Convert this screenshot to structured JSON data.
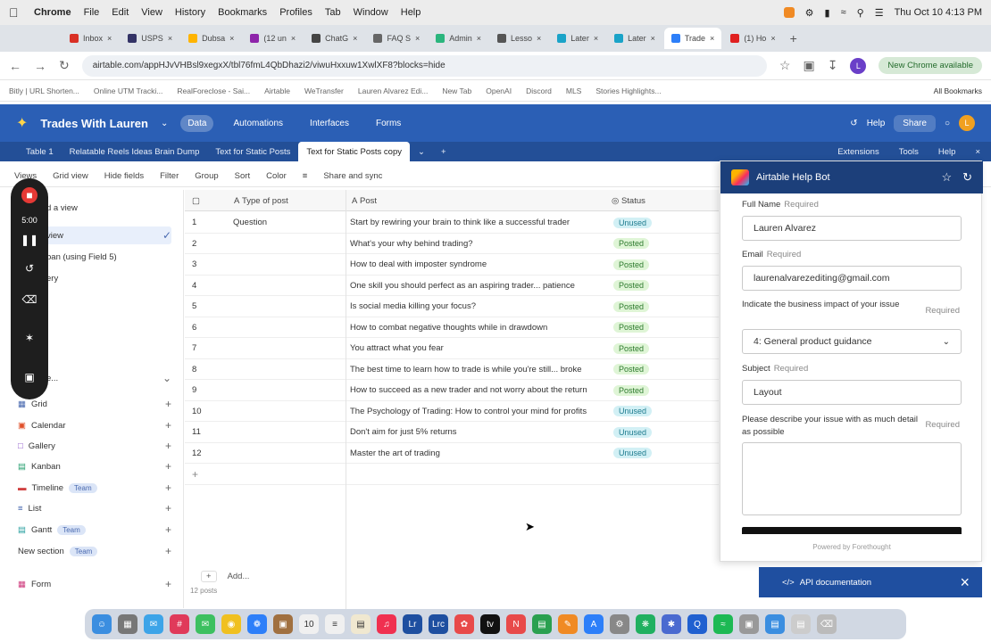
{
  "menubar": {
    "app": "Chrome",
    "menus": [
      "File",
      "Edit",
      "View",
      "History",
      "Bookmarks",
      "Profiles",
      "Tab",
      "Window",
      "Help"
    ],
    "clock": "Thu Oct 10  4:13 PM"
  },
  "tabs": [
    {
      "label": "Inbox",
      "color": "#d93025"
    },
    {
      "label": "USPS",
      "color": "#333366"
    },
    {
      "label": "Dubsa",
      "color": "#ffb400"
    },
    {
      "label": "(12 un",
      "color": "#8e24aa"
    },
    {
      "label": "ChatG",
      "color": "#444"
    },
    {
      "label": "FAQ S",
      "color": "#666"
    },
    {
      "label": "Admin",
      "color": "#2ab57d"
    },
    {
      "label": "Lesso",
      "color": "#555"
    },
    {
      "label": "Later",
      "color": "#1aa3c8"
    },
    {
      "label": "Later",
      "color": "#1aa3c8"
    },
    {
      "label": "Trade",
      "color": "#2d7ff9",
      "active": true
    },
    {
      "label": "(1) Ho",
      "color": "#e02020"
    }
  ],
  "address": {
    "url": "airtable.com/appHJvVHBsl9xegxX/tbl76fmL4QbDhazi2/viwuHxxuw1XwlXF8?blocks=hide",
    "update": "New Chrome available"
  },
  "bookmarks": [
    "Bitly | URL Shorten...",
    "Online UTM Tracki...",
    "RealForeclose - Sai...",
    "Airtable",
    "WeTransfer",
    "Lauren Alvarez Edi...",
    "New Tab",
    "OpenAI",
    "Discord",
    "MLS",
    "Stories Highlights..."
  ],
  "all_bookmarks": "All Bookmarks",
  "header": {
    "base_name": "Trades With Lauren",
    "nav": [
      "Data",
      "Automations",
      "Interfaces",
      "Forms"
    ],
    "help": "Help",
    "share": "Share",
    "avatar": "L"
  },
  "table_tabs": [
    "Table 1",
    "Relatable Reels Ideas Brain Dump",
    "Text for Static Posts",
    "Text for Static Posts copy"
  ],
  "table_tabs_right": [
    "Extensions",
    "Tools",
    "Help"
  ],
  "toolbar": {
    "views": "Views",
    "view": "Grid view",
    "items": [
      "Hide fields",
      "Filter",
      "Group",
      "Sort",
      "Color"
    ],
    "share": "Share and sync"
  },
  "recorder": {
    "timer": "5:00"
  },
  "sidebar": {
    "partials": [
      "d a view",
      "view",
      "ban (using Field 5)",
      "ery",
      "e..."
    ],
    "create": [
      {
        "label": "Grid"
      },
      {
        "label": "Calendar"
      },
      {
        "label": "Gallery"
      },
      {
        "label": "Kanban"
      },
      {
        "label": "Timeline",
        "badge": "Team"
      },
      {
        "label": "List"
      },
      {
        "label": "Gantt",
        "badge": "Team"
      },
      {
        "label": "New section",
        "badge": "Team"
      },
      {
        "label": "Form"
      }
    ]
  },
  "grid": {
    "columns": [
      "Type of post",
      "Post",
      "Status"
    ],
    "rows": [
      {
        "n": "1",
        "type": "Question",
        "post": "Start by rewiring your brain to think like a successful trader",
        "status": "Unused"
      },
      {
        "n": "2",
        "type": "",
        "post": "What's your why behind trading?",
        "status": "Posted"
      },
      {
        "n": "3",
        "type": "",
        "post": "How to deal with imposter syndrome",
        "status": "Posted"
      },
      {
        "n": "4",
        "type": "",
        "post": "One skill you should perfect as an aspiring trader... patience",
        "status": "Posted"
      },
      {
        "n": "5",
        "type": "",
        "post": "Is social media killing your focus?",
        "status": "Posted"
      },
      {
        "n": "6",
        "type": "",
        "post": "How to combat negative thoughts while in drawdown",
        "status": "Posted"
      },
      {
        "n": "7",
        "type": "",
        "post": "You attract what you fear",
        "status": "Posted"
      },
      {
        "n": "8",
        "type": "",
        "post": "The best time to learn how to trade is while you're still... broke",
        "status": "Posted"
      },
      {
        "n": "9",
        "type": "",
        "post": "How to succeed as a new trader and not worry about the return",
        "status": "Posted"
      },
      {
        "n": "10",
        "type": "",
        "post": "The Psychology of Trading: How to control your mind for profits",
        "status": "Unused"
      },
      {
        "n": "11",
        "type": "",
        "post": "Don't aim for just 5% returns",
        "status": "Unused"
      },
      {
        "n": "12",
        "type": "",
        "post": "Master the art of trading",
        "status": "Unused"
      }
    ],
    "add": "Add...",
    "count": "12 posts"
  },
  "help": {
    "title": "Airtable Help Bot",
    "full_name_label": "Full Name",
    "full_name": "Lauren Alvarez",
    "email_label": "Email",
    "email": "laurenalvarezediting@gmail.com",
    "impact_label": "Indicate the business impact of your issue",
    "impact_value": "4: General product guidance",
    "subject_label": "Subject",
    "subject": "Layout",
    "describe_label": "Please describe your issue with as much detail as possible",
    "required": "Required",
    "powered": "Powered by  Forethought",
    "api_doc": "API documentation"
  },
  "colors": {
    "header": "#2b5fb5",
    "posted": "#dff5d6",
    "unused": "#d2f0f5"
  }
}
